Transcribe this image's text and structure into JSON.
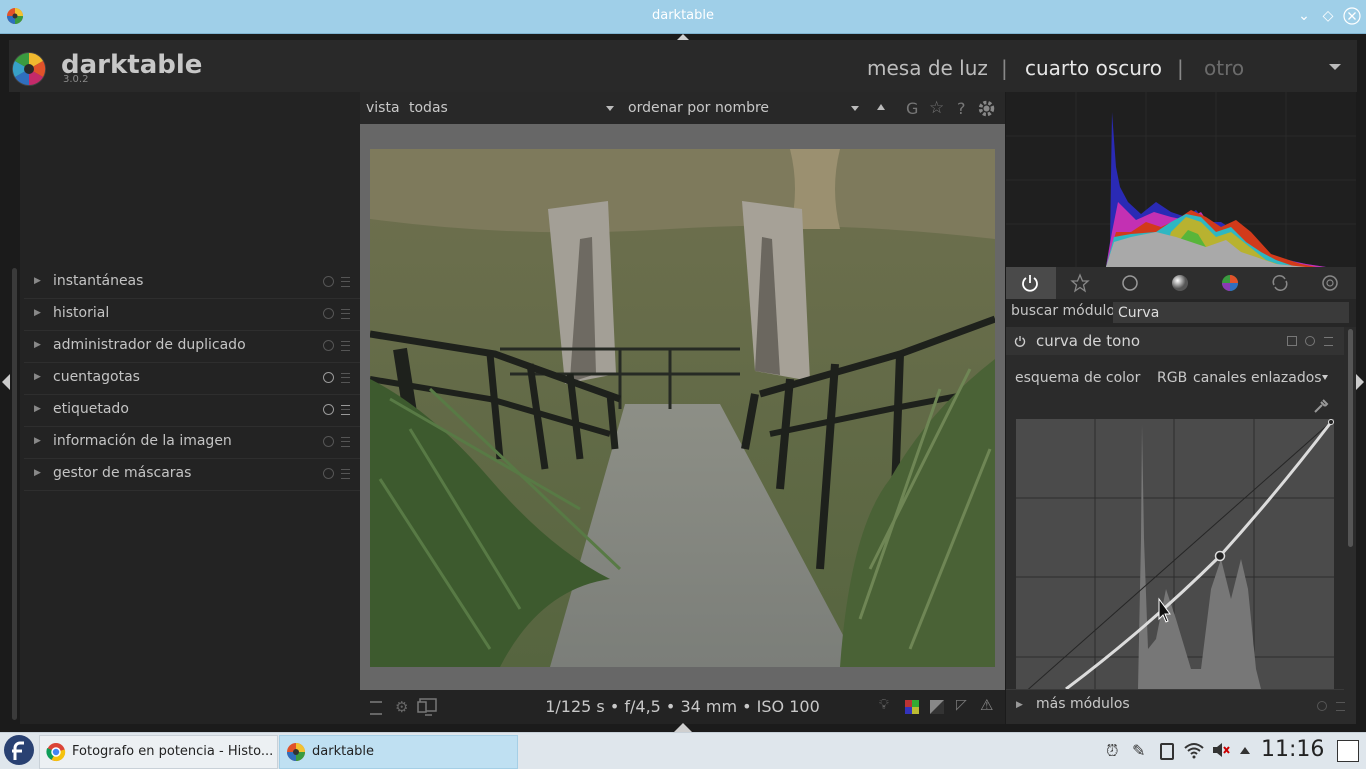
{
  "window": {
    "title": "darktable"
  },
  "app": {
    "name": "darktable",
    "version": "3.0.2"
  },
  "views": {
    "lighttable": "mesa de luz",
    "sep1": "|",
    "darkroom": "cuarto oscuro",
    "sep2": "|",
    "other": "otro"
  },
  "filmstrip_bar": {
    "view_label": "vista",
    "view_value": "todas",
    "sort_label": "ordenar por",
    "sort_value": "nombre",
    "g_label": "G",
    "help_label": "?"
  },
  "left_modules": [
    {
      "label": "instantáneas"
    },
    {
      "label": "historial"
    },
    {
      "label": "administrador de duplicado"
    },
    {
      "label": "cuentagotas"
    },
    {
      "label": "etiquetado"
    },
    {
      "label": "información de la imagen"
    },
    {
      "label": "gestor de máscaras"
    }
  ],
  "image_info": "1/125 s • f/4,5 • 34 mm • ISO 100",
  "search": {
    "label": "buscar módulo",
    "value": "Curva"
  },
  "tone_curve": {
    "title": "curva de tono",
    "scheme_label": "esquema de color",
    "scheme_value": "RGB",
    "channels_value": "canales enlazados"
  },
  "more_modules": "más módulos",
  "taskbar": {
    "tasks": [
      {
        "label": "Fotografo en potencia - Histo..."
      },
      {
        "label": "darktable"
      }
    ],
    "clock": "11:16"
  },
  "colors": {
    "titlebar": "#9fcfe8",
    "panel_bg": "#232323",
    "accent": "#d8e9f4"
  }
}
